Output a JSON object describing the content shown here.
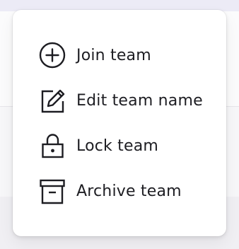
{
  "menu": {
    "items": [
      {
        "label": "Join team",
        "icon": "plus-circle-icon"
      },
      {
        "label": "Edit team name",
        "icon": "edit-icon"
      },
      {
        "label": "Lock team",
        "icon": "lock-icon"
      },
      {
        "label": "Archive team",
        "icon": "archive-box-icon"
      }
    ]
  },
  "colors": {
    "text": "#1d1d22",
    "icon_stroke": "#1d1d22",
    "menu_background": "#ffffff",
    "page_background": "#f2f1f5"
  }
}
